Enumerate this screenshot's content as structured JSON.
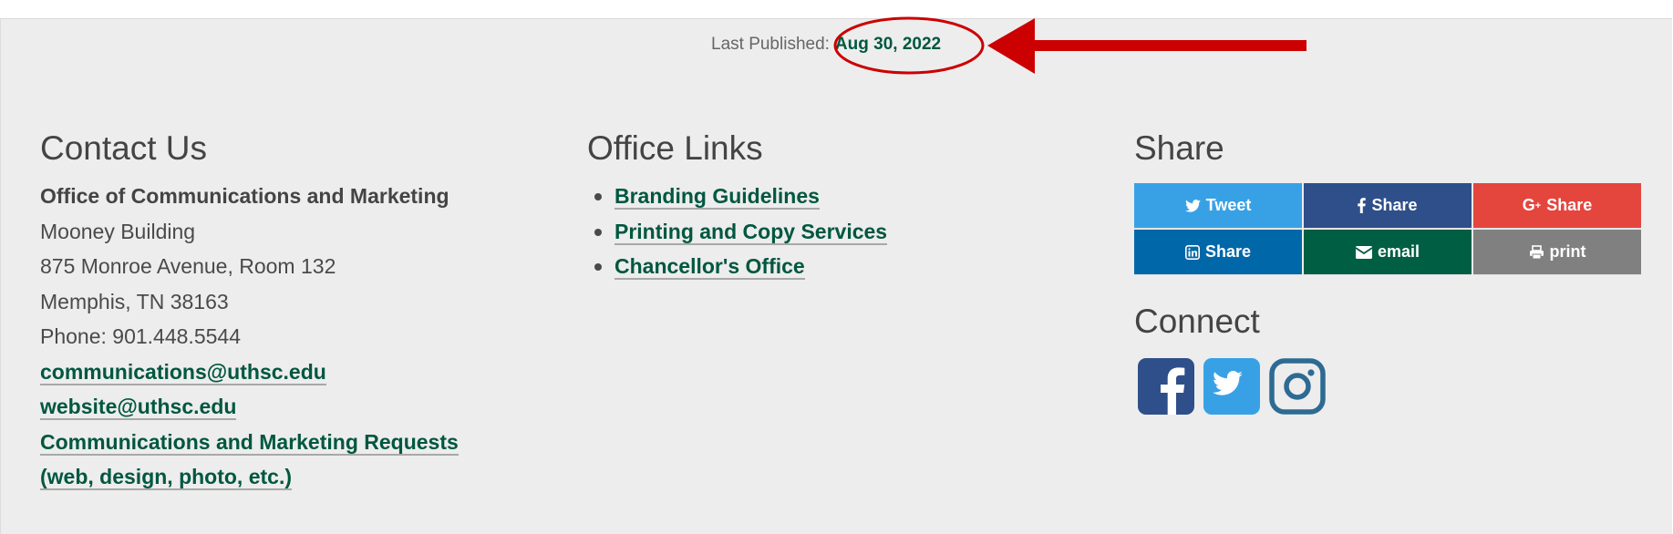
{
  "published": {
    "label": "Last Published:",
    "date": "Aug 30, 2022"
  },
  "annotation": {
    "color": "#cc0000",
    "shapes": [
      "ellipse-around-date",
      "arrow-pointing-left-at-date"
    ]
  },
  "contact": {
    "title": "Contact Us",
    "org": "Office of Communications and Marketing",
    "building": "Mooney Building",
    "address": "875 Monroe Avenue, Room 132",
    "city": "Memphis, TN 38163",
    "phone": "Phone: 901.448.5544",
    "email_1": "communications@uthsc.edu",
    "email_2": "website@uthsc.edu",
    "requests_line1": "Communications and Marketing Requests",
    "requests_line2": "(web, design, photo, etc.)"
  },
  "office_links": {
    "title": "Office Links",
    "items": [
      {
        "label": "Branding Guidelines"
      },
      {
        "label": "Printing and Copy Services"
      },
      {
        "label": "Chancellor's Office"
      }
    ]
  },
  "share": {
    "title": "Share",
    "buttons": [
      {
        "label": "Tweet",
        "icon": "twitter-icon",
        "color": "#38a1e6"
      },
      {
        "label": "Share",
        "icon": "facebook-icon",
        "color": "#2f4f8a"
      },
      {
        "label": "Share",
        "icon": "google-plus-icon",
        "color": "#e4463e"
      },
      {
        "label": "Share",
        "icon": "linkedin-icon",
        "color": "#0068a8"
      },
      {
        "label": "email",
        "icon": "envelope-icon",
        "color": "#005f43"
      },
      {
        "label": "print",
        "icon": "print-icon",
        "color": "#808080"
      }
    ]
  },
  "connect": {
    "title": "Connect",
    "icons": [
      {
        "name": "facebook",
        "color": "#2f4f8a"
      },
      {
        "name": "twitter",
        "color": "#38a1e6"
      },
      {
        "name": "instagram",
        "color": "#2d6b93"
      }
    ]
  },
  "colors": {
    "link_green": "#00573f",
    "footer_bg": "#ededed",
    "heading_gray": "#444444"
  }
}
